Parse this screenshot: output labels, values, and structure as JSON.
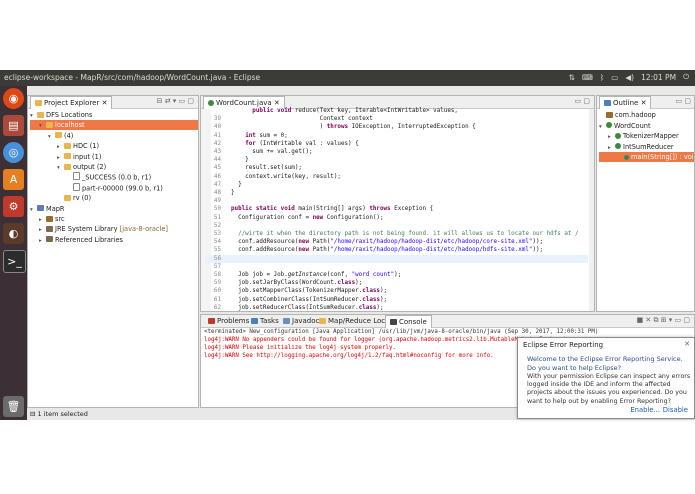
{
  "window": {
    "title": "eclipse-workspace - MapR/src/com/hadoop/WordCount.java - Eclipse",
    "time": "12:01 PM"
  },
  "project_explorer": {
    "tab_label": "Project Explorer",
    "tree": [
      {
        "label": "DFS Locations",
        "indent": 0,
        "icon": "folder",
        "twisty": "▾"
      },
      {
        "label": "localhost",
        "indent": 1,
        "icon": "folder",
        "twisty": "▾",
        "selected": true
      },
      {
        "label": "(4)",
        "indent": 2,
        "icon": "folder",
        "twisty": "▾"
      },
      {
        "label": "HDC (1)",
        "indent": 3,
        "icon": "folder",
        "twisty": "▸"
      },
      {
        "label": "input (1)",
        "indent": 3,
        "icon": "folder",
        "twisty": "▸"
      },
      {
        "label": "output (2)",
        "indent": 3,
        "icon": "folder",
        "twisty": "▾"
      },
      {
        "label": "_SUCCESS (0.0 b, r1)",
        "indent": 4,
        "icon": "file",
        "twisty": ""
      },
      {
        "label": "part-r-00000 (99.0 b, r1)",
        "indent": 4,
        "icon": "file",
        "twisty": ""
      },
      {
        "label": "rv (0)",
        "indent": 3,
        "icon": "folder",
        "twisty": ""
      },
      {
        "label": "MapR",
        "indent": 0,
        "icon": "proj",
        "twisty": "▾"
      },
      {
        "label": "src",
        "indent": 1,
        "icon": "pkg",
        "twisty": "▸"
      },
      {
        "label": "JRE System Library",
        "suffix": " [java-8-oracle]",
        "indent": 1,
        "icon": "jar",
        "twisty": "▸"
      },
      {
        "label": "Referenced Libraries",
        "indent": 1,
        "icon": "jar",
        "twisty": "▸"
      }
    ]
  },
  "editor": {
    "tab_label": "WordCount.java",
    "lines": [
      {
        "n": "",
        "html": "      <span class=\"kw\">public</span> <span class=\"kw\">void</span> reduce(Text key, Iterable&lt;IntWritable&gt; values,"
      },
      {
        "n": "39",
        "html": "                         Context context"
      },
      {
        "n": "40",
        "html": "                         ) <span class=\"kw\">throws</span> IOException, InterruptedException {"
      },
      {
        "n": "41",
        "html": "    <span class=\"kw\">int</span> sum = 0;"
      },
      {
        "n": "42",
        "html": "    <span class=\"kw\">for</span> (IntWritable val : values) {"
      },
      {
        "n": "43",
        "html": "      sum += val.get();"
      },
      {
        "n": "44",
        "html": "    }"
      },
      {
        "n": "45",
        "html": "    result.set(sum);"
      },
      {
        "n": "46",
        "html": "    context.write(key, result);"
      },
      {
        "n": "47",
        "html": "  }"
      },
      {
        "n": "48",
        "html": "}"
      },
      {
        "n": "49",
        "html": ""
      },
      {
        "n": "50",
        "html": "<span class=\"kw\">public</span> <span class=\"kw\">static</span> <span class=\"kw\">void</span> main(String[] args) <span class=\"kw\">throws</span> Exception {"
      },
      {
        "n": "51",
        "html": "  Configuration conf = <span class=\"kw\">new</span> Configuration();"
      },
      {
        "n": "52",
        "html": ""
      },
      {
        "n": "53",
        "html": "  <span class=\"cm\">//wirte it when the directory path is not being found. it will allows us to locate our hdfs at /</span>"
      },
      {
        "n": "54",
        "html": "  conf.addResource(<span class=\"kw\">new</span> Path(<span class=\"str\">\"/home/raxit/hadoop/hadoop-dist/etc/hadoop/core-site.xml\"</span>));"
      },
      {
        "n": "55",
        "html": "  conf.addResource(<span class=\"kw\">new</span> Path(<span class=\"str\">\"/home/raxit/hadoop/hadoop-dist/etc/hadoop/hdfs-site.xml\"</span>));"
      },
      {
        "n": "56",
        "html": ""
      },
      {
        "n": "57",
        "html": ""
      },
      {
        "n": "58",
        "html": "  Job job = Job.<i>getInstance</i>(conf, <span class=\"str\">\"word count\"</span>);"
      },
      {
        "n": "59",
        "html": "  job.setJarByClass(WordCount.<span class=\"kw\">class</span>);"
      },
      {
        "n": "60",
        "html": "  job.setMapperClass(TokenizerMapper.<span class=\"kw\">class</span>);"
      },
      {
        "n": "61",
        "html": "  job.setCombinerClass(IntSumReducer.<span class=\"kw\">class</span>);"
      },
      {
        "n": "62",
        "html": "  job.setReducerClass(IntSumReducer.<span class=\"kw\">class</span>);"
      },
      {
        "n": "63",
        "html": "  job.setOutputKeyClass(Text.<span class=\"kw\">class</span>);"
      },
      {
        "n": "64",
        "html": "  job.setOutputValueClass(IntWritable.<span class=\"kw\">class</span>);"
      },
      {
        "n": "65",
        "html": "  FileInputFormat.<i>addInputPath</i>(job, <span class=\"kw\">new</span> Path(args[0]));"
      },
      {
        "n": "66",
        "html": "  FileOutputFormat.<i>setOutputPath</i>(job, <span class=\"kw\">new</span> Path(args[1]));"
      },
      {
        "n": "67",
        "html": "  System.<i>exit</i>(job.waitForCompletion(<span class=\"kw\">true</span>) ? 0 : 1);"
      },
      {
        "n": "68",
        "html": "}"
      },
      {
        "n": "69",
        "html": "}"
      }
    ]
  },
  "outline": {
    "tab_label": "Outline",
    "tree": [
      {
        "label": "com.hadoop",
        "indent": 0,
        "icon": "pkg",
        "twisty": ""
      },
      {
        "label": "WordCount",
        "indent": 0,
        "icon": "jcls",
        "twisty": "▾"
      },
      {
        "label": "TokenizerMapper",
        "indent": 1,
        "icon": "jcls",
        "twisty": "▸"
      },
      {
        "label": "IntSumReducer",
        "indent": 1,
        "icon": "jcls",
        "twisty": "▸"
      },
      {
        "label": "main(String[]) : void",
        "indent": 2,
        "icon": "meth",
        "twisty": "",
        "selected": true
      }
    ]
  },
  "bottom_tabs": [
    "Problems",
    "Tasks",
    "Javadoc",
    "Map/Reduce Locations",
    "Console"
  ],
  "console": {
    "header": "<terminated> New_configuration [Java Application] /usr/lib/jvm/java-8-oracle/bin/java (Sep 30, 2017, 12:00:31 PM)",
    "lines": [
      "log4j:WARN No appenders could be found for logger (org.apache.hadoop.metrics2.lib.MutableMetricsFactory).",
      "log4j:WARN Please initialize the log4j system properly.",
      "log4j:WARN See http://logging.apache.org/log4j/1.2/faq.html#noconfig for more info."
    ]
  },
  "error_popup": {
    "title": "Eclipse Error Reporting",
    "welcome": "Welcome to the Eclipse Error Reporting Service.",
    "question": "Do you want to help Eclipse?",
    "body": "With your permission Eclipse can inspect any errors logged inside the IDE and inform the affected projects about the issues you experienced. Do you want to help out by enabling Error Reporting?",
    "enable_label": "Enable...",
    "disable_label": "Disable"
  },
  "status": {
    "text": "1 item selected"
  },
  "colors": {
    "selection": "#f07746",
    "topbar": "#3c3b37",
    "launcher": "#3c2f36",
    "console_error": "#e00000"
  }
}
